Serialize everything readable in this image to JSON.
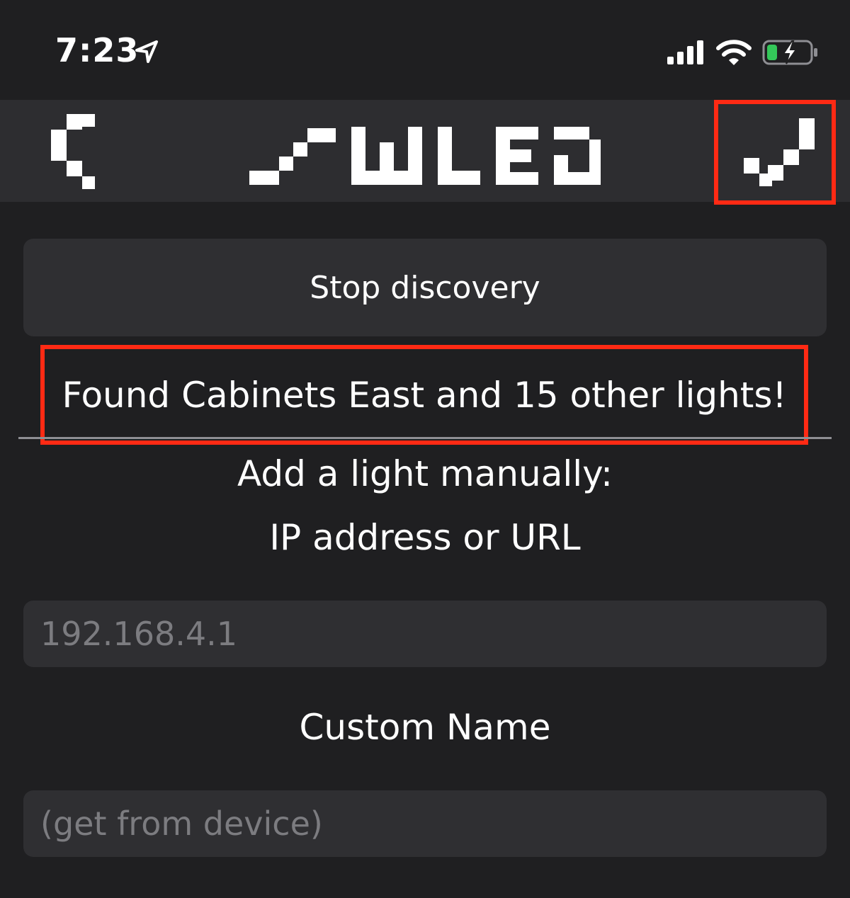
{
  "status_bar": {
    "time": "7:23",
    "icons": [
      "location-arrow-icon",
      "cellular-signal-icon",
      "wifi-icon",
      "battery-charging-icon"
    ]
  },
  "nav_bar": {
    "back_icon": "chevron-left-icon",
    "logo_text": "WLED",
    "confirm_icon": "checkmark-icon"
  },
  "discovery": {
    "stop_label": "Stop discovery",
    "found_message": "Found Cabinets East and 15 other lights!"
  },
  "manual": {
    "title": "Add a light manually:",
    "subtitle": "IP address or URL",
    "ip_placeholder": "192.168.4.1",
    "ip_value": "",
    "name_label": "Custom Name",
    "name_placeholder": "(get from device)",
    "name_value": ""
  },
  "colors": {
    "background": "#1f1f21",
    "nav_background": "#2d2d30",
    "field_background": "#2f2f32",
    "highlight": "#ff2a14",
    "battery_green": "#34c759"
  }
}
